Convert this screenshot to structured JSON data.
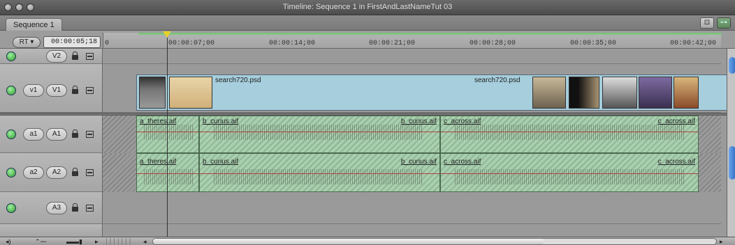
{
  "window": {
    "title": "Timeline: Sequence 1 in FirstAndLastNameTut 03"
  },
  "tabs": [
    {
      "label": "Sequence 1"
    }
  ],
  "toolbar": {
    "rt_label": "RT ▾",
    "timecode": "00:00:05;18",
    "snap_icon": "snapping-icon",
    "link_icon": "linking-icon"
  },
  "ruler": {
    "ticks": [
      "0",
      "00:00:07;00",
      "00:00:14;00",
      "00:00:21;00",
      "00:00:28;00",
      "00:00:35;00",
      "00:00:42;00"
    ]
  },
  "tracks": {
    "v2": {
      "dest": "V2"
    },
    "v1": {
      "source": "v1",
      "dest": "V1",
      "clip_name_left": "search720.psd",
      "clip_name_right": "search720.psd"
    },
    "a1": {
      "source": "a1",
      "dest": "A1"
    },
    "a2": {
      "source": "a2",
      "dest": "A2"
    },
    "a3": {
      "dest": "A3"
    }
  },
  "audio_clips": {
    "a1": [
      "a_theres.aif",
      "b_curius.aif",
      "b_curius.aif",
      "c_across.aif",
      "c_across.aif"
    ],
    "a2": [
      "a_theres.aif",
      "b_curius.aif",
      "b_curius.aif",
      "c_across.aif",
      "c_across.aif"
    ]
  },
  "colors": {
    "video_clip": "#a6cedc",
    "audio_clip": "#a8cfae",
    "render_bar": "#7fc47f",
    "playhead": "#e6d02a"
  }
}
